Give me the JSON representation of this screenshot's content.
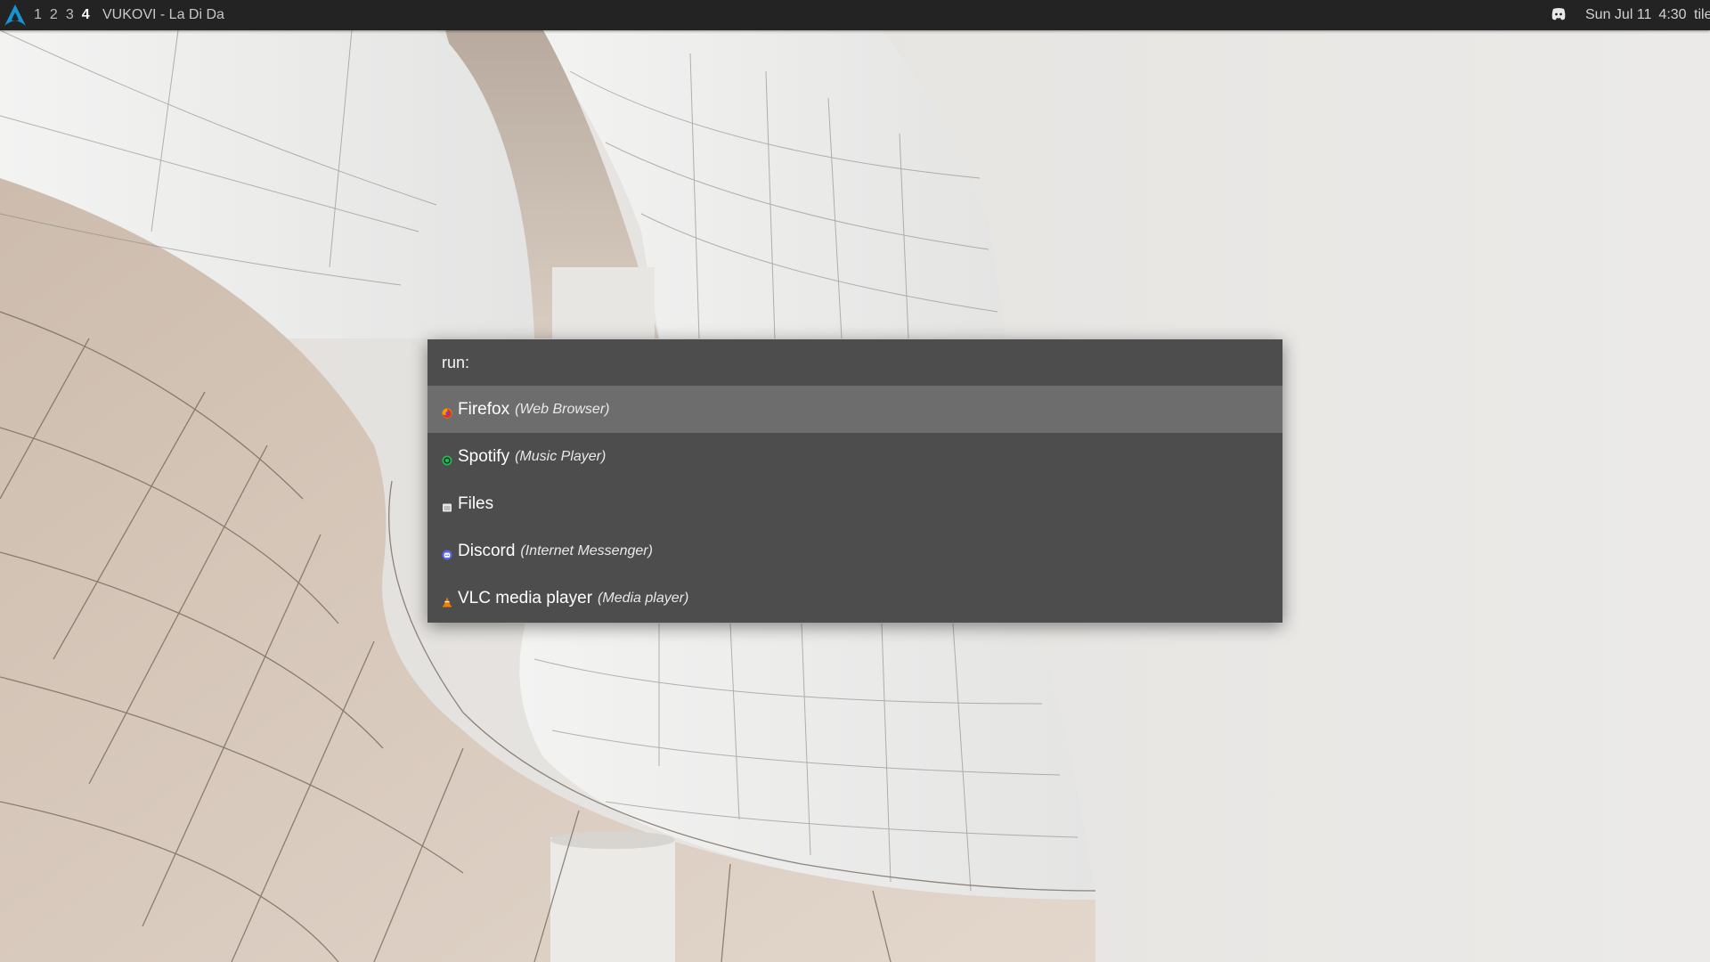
{
  "topbar": {
    "logo_icon": "arch-linux-icon",
    "workspaces": [
      {
        "label": "1",
        "active": false
      },
      {
        "label": "2",
        "active": false
      },
      {
        "label": "3",
        "active": false
      },
      {
        "label": "4",
        "active": true
      }
    ],
    "window_title": "VUKOVI - La Di Da",
    "tray_icon": "discord-icon",
    "date": "Sun Jul 11",
    "time": "4:30",
    "layout": "tile"
  },
  "launcher": {
    "prompt": "run:",
    "query": "",
    "entries": [
      {
        "name": "Firefox",
        "desc": "(Web Browser)",
        "icon": "firefox-icon",
        "color": "#e66000",
        "selected": true
      },
      {
        "name": "Spotify",
        "desc": "(Music Player)",
        "icon": "spotify-icon",
        "color": "#1db954",
        "selected": false
      },
      {
        "name": "Files",
        "desc": "",
        "icon": "files-icon",
        "color": "#e0e0e0",
        "selected": false
      },
      {
        "name": "Discord",
        "desc": "(Internet Messenger)",
        "icon": "discord-icon",
        "color": "#5865f2",
        "selected": false
      },
      {
        "name": "VLC media player",
        "desc": "(Media player)",
        "icon": "vlc-icon",
        "color": "#f08000",
        "selected": false
      }
    ]
  },
  "colors": {
    "topbar_bg": "#232323",
    "accent": "#1793d1",
    "launcher_bg": "#444444",
    "selected_bg": "#787878"
  }
}
